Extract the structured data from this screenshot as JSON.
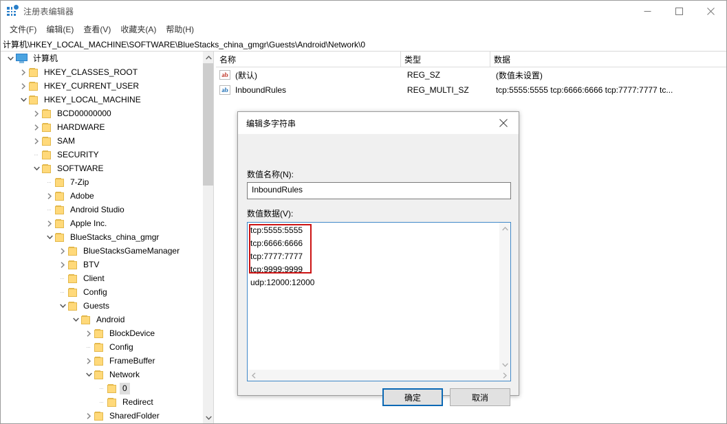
{
  "window": {
    "title": "注册表编辑器",
    "icon": "registry-icon",
    "controls": {
      "minimize": "minimize-icon",
      "maximize": "maximize-icon",
      "close": "close-icon"
    }
  },
  "menubar": {
    "items": [
      {
        "label": "文件(F)"
      },
      {
        "label": "编辑(E)"
      },
      {
        "label": "查看(V)"
      },
      {
        "label": "收藏夹(A)"
      },
      {
        "label": "帮助(H)"
      }
    ]
  },
  "address": {
    "path": "计算机\\HKEY_LOCAL_MACHINE\\SOFTWARE\\BlueStacks_china_gmgr\\Guests\\Android\\Network\\0"
  },
  "tree": {
    "items": [
      {
        "label": "计算机",
        "depth": 0,
        "expander": "down",
        "icon": "computer-icon",
        "selected": false
      },
      {
        "label": "HKEY_CLASSES_ROOT",
        "depth": 1,
        "expander": "right",
        "icon": "folder-icon",
        "selected": false
      },
      {
        "label": "HKEY_CURRENT_USER",
        "depth": 1,
        "expander": "right",
        "icon": "folder-icon",
        "selected": false
      },
      {
        "label": "HKEY_LOCAL_MACHINE",
        "depth": 1,
        "expander": "down",
        "icon": "folder-icon",
        "selected": false
      },
      {
        "label": "BCD00000000",
        "depth": 2,
        "expander": "right",
        "icon": "folder-icon",
        "selected": false
      },
      {
        "label": "HARDWARE",
        "depth": 2,
        "expander": "right",
        "icon": "folder-icon",
        "selected": false
      },
      {
        "label": "SAM",
        "depth": 2,
        "expander": "right",
        "icon": "folder-icon",
        "selected": false
      },
      {
        "label": "SECURITY",
        "depth": 2,
        "expander": "none",
        "icon": "folder-icon",
        "selected": false
      },
      {
        "label": "SOFTWARE",
        "depth": 2,
        "expander": "down",
        "icon": "folder-icon",
        "selected": false
      },
      {
        "label": "7-Zip",
        "depth": 3,
        "expander": "none",
        "icon": "folder-icon",
        "selected": false
      },
      {
        "label": "Adobe",
        "depth": 3,
        "expander": "right",
        "icon": "folder-icon",
        "selected": false
      },
      {
        "label": "Android Studio",
        "depth": 3,
        "expander": "none",
        "icon": "folder-icon",
        "selected": false
      },
      {
        "label": "Apple Inc.",
        "depth": 3,
        "expander": "right",
        "icon": "folder-icon",
        "selected": false
      },
      {
        "label": "BlueStacks_china_gmgr",
        "depth": 3,
        "expander": "down",
        "icon": "folder-icon",
        "selected": false
      },
      {
        "label": "BlueStacksGameManager",
        "depth": 4,
        "expander": "right",
        "icon": "folder-icon",
        "selected": false
      },
      {
        "label": "BTV",
        "depth": 4,
        "expander": "right",
        "icon": "folder-icon",
        "selected": false
      },
      {
        "label": "Client",
        "depth": 4,
        "expander": "none",
        "icon": "folder-icon",
        "selected": false
      },
      {
        "label": "Config",
        "depth": 4,
        "expander": "none",
        "icon": "folder-icon",
        "selected": false
      },
      {
        "label": "Guests",
        "depth": 4,
        "expander": "down",
        "icon": "folder-icon",
        "selected": false
      },
      {
        "label": "Android",
        "depth": 5,
        "expander": "down",
        "icon": "folder-icon",
        "selected": false
      },
      {
        "label": "BlockDevice",
        "depth": 6,
        "expander": "right",
        "icon": "folder-icon",
        "selected": false
      },
      {
        "label": "Config",
        "depth": 6,
        "expander": "none",
        "icon": "folder-icon",
        "selected": false
      },
      {
        "label": "FrameBuffer",
        "depth": 6,
        "expander": "right",
        "icon": "folder-icon",
        "selected": false
      },
      {
        "label": "Network",
        "depth": 6,
        "expander": "down",
        "icon": "folder-icon",
        "selected": false
      },
      {
        "label": "0",
        "depth": 7,
        "expander": "none",
        "icon": "folder-icon",
        "selected": true
      },
      {
        "label": "Redirect",
        "depth": 7,
        "expander": "none",
        "icon": "folder-icon",
        "selected": false
      },
      {
        "label": "SharedFolder",
        "depth": 6,
        "expander": "right",
        "icon": "folder-icon",
        "selected": false
      }
    ]
  },
  "list": {
    "columns": [
      {
        "label": "名称"
      },
      {
        "label": "类型"
      },
      {
        "label": "数据"
      }
    ],
    "rows": [
      {
        "icon": "string-value-icon-default",
        "name": "(默认)",
        "type": "REG_SZ",
        "data": "(数值未设置)"
      },
      {
        "icon": "string-value-icon",
        "name": "InboundRules",
        "type": "REG_MULTI_SZ",
        "data": "tcp:5555:5555 tcp:6666:6666 tcp:7777:7777 tc..."
      }
    ]
  },
  "dialog": {
    "title": "编辑多字符串",
    "close_label": "close-icon",
    "name_label": "数值名称(N):",
    "name_value": "InboundRules",
    "data_label": "数值数据(V):",
    "data_value": "tcp:5555:5555\ntcp:6666:6666\ntcp:7777:7777\ntcp:9999:9999\nudp:12000:12000",
    "ok_label": "确定",
    "cancel_label": "取消",
    "annotation_color": "#cc1111"
  }
}
